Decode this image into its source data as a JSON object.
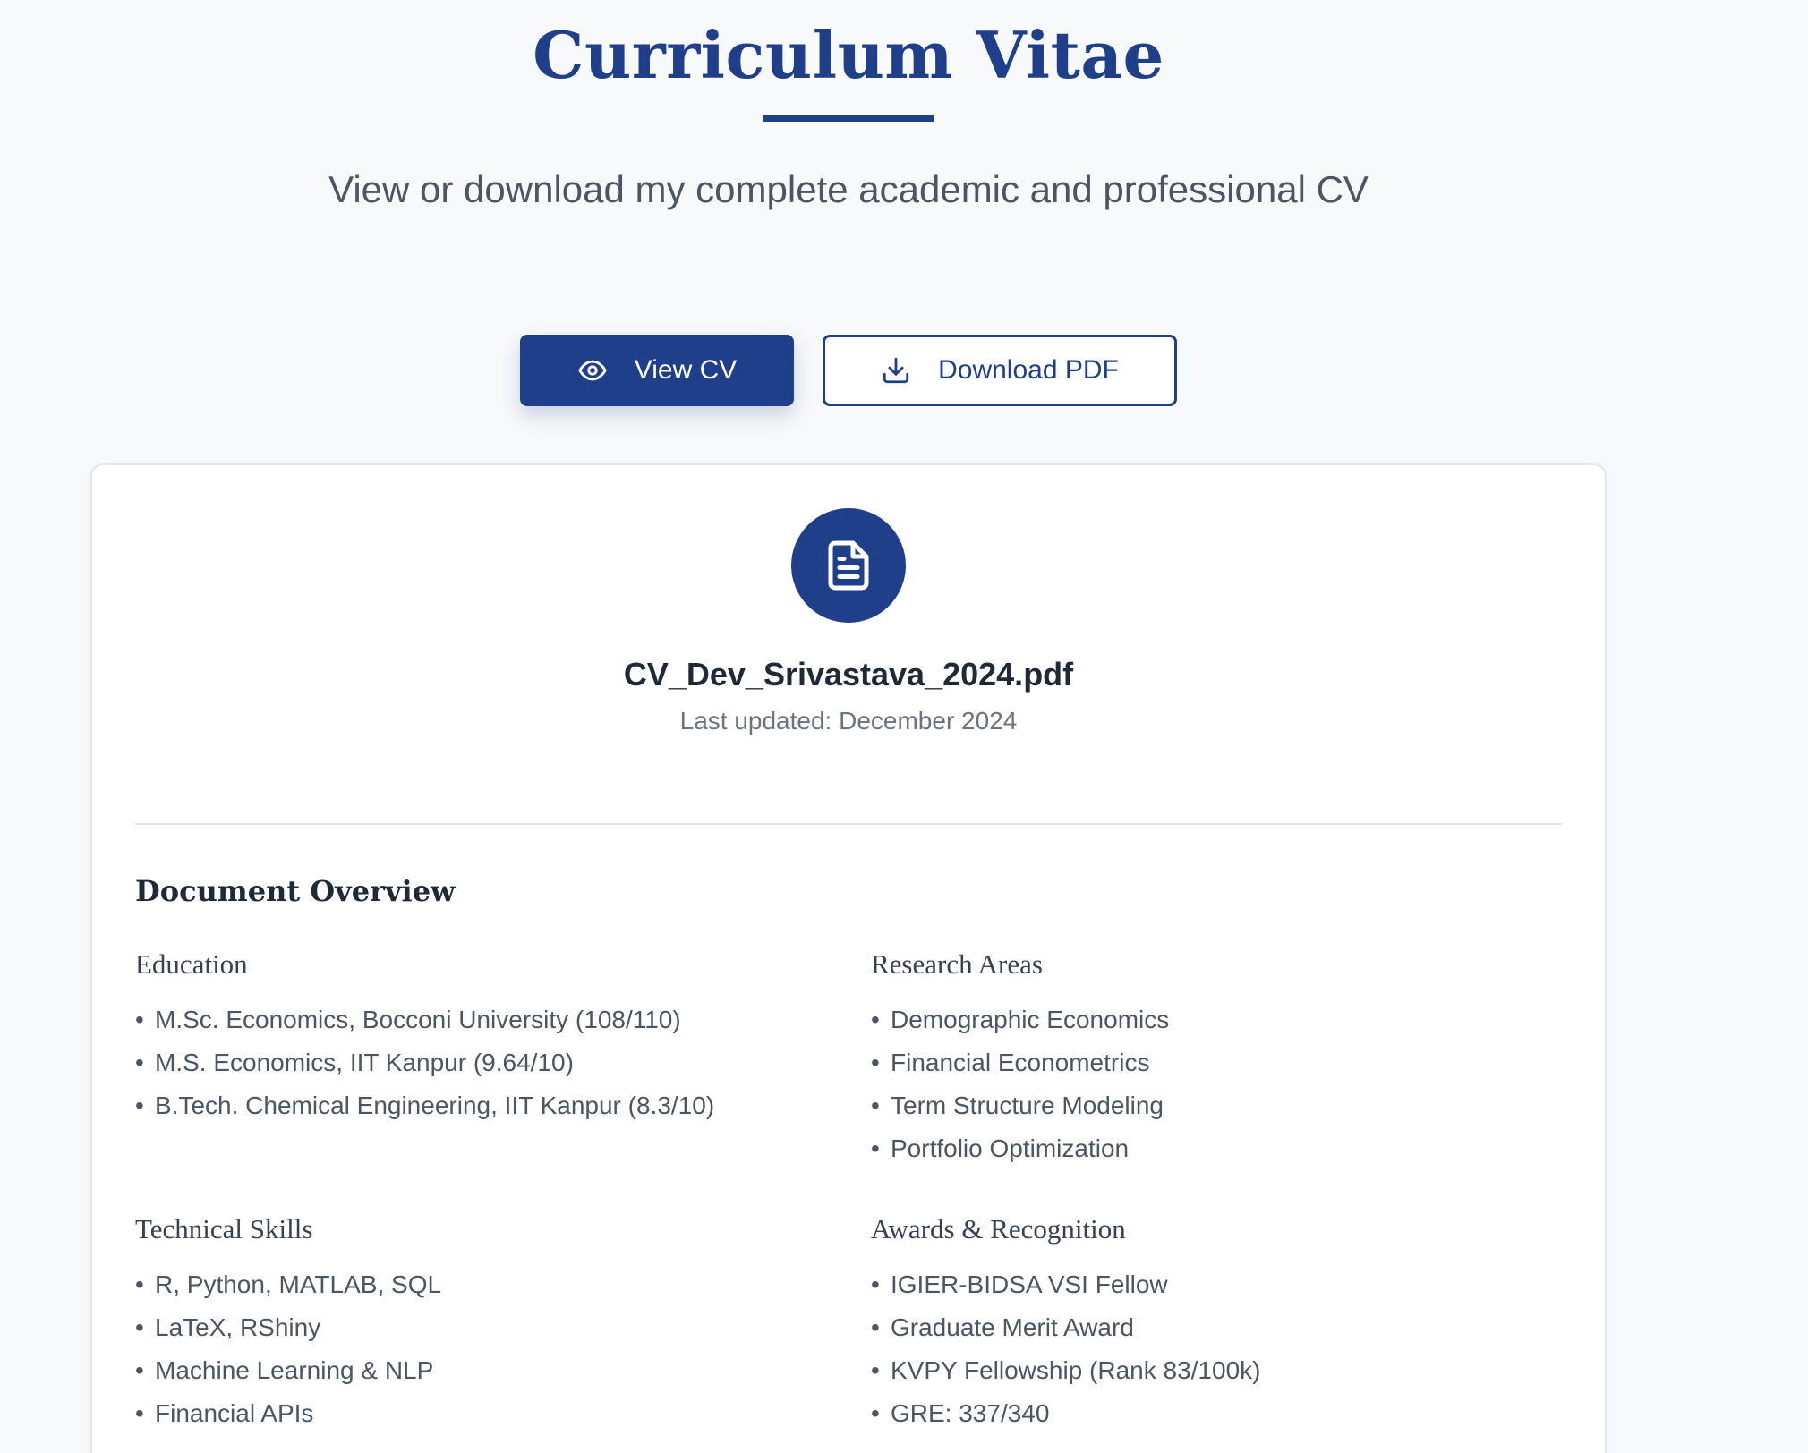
{
  "header": {
    "title": "Curriculum Vitae",
    "subtitle": "View or download my complete academic and professional CV"
  },
  "actions": {
    "view_label": "View CV",
    "view_icon": "eye-icon",
    "download_label": "Download PDF",
    "download_icon": "download-icon"
  },
  "document": {
    "icon": "document-icon",
    "file_name": "CV_Dev_Srivastava_2024.pdf",
    "last_updated": "Last updated: December 2024"
  },
  "overview": {
    "title": "Document Overview",
    "sections": [
      {
        "title": "Education",
        "items": [
          "M.Sc. Economics, Bocconi University (108/110)",
          "M.S. Economics, IIT Kanpur (9.64/10)",
          "B.Tech. Chemical Engineering, IIT Kanpur (8.3/10)"
        ]
      },
      {
        "title": "Research Areas",
        "items": [
          "Demographic Economics",
          "Financial Econometrics",
          "Term Structure Modeling",
          "Portfolio Optimization"
        ]
      },
      {
        "title": "Technical Skills",
        "items": [
          "R, Python, MATLAB, SQL",
          "LaTeX, RShiny",
          "Machine Learning & NLP",
          "Financial APIs"
        ]
      },
      {
        "title": "Awards & Recognition",
        "items": [
          "IGIER-BIDSA VSI Fellow",
          "Graduate Merit Award",
          "KVPY Fellowship (Rank 83/100k)",
          "GRE: 337/340"
        ]
      }
    ]
  },
  "colors": {
    "primary": "#1f3f8a",
    "background": "#f8f9fb",
    "card": "#ffffff",
    "text_muted": "#4b5563"
  }
}
